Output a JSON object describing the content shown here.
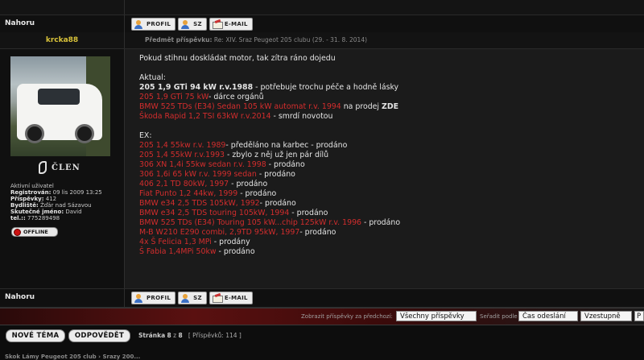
{
  "nav": {
    "top_label": "Nahoru",
    "bottom_label": "Nahoru"
  },
  "buttons": {
    "profile": "PROFIL",
    "pm": "SZ",
    "email": "E-MAIL"
  },
  "post": {
    "author": "krcka88",
    "subject_label": "Předmět příspěvku:",
    "subject": "Re: XIV. Sraz Peugeot 205 clubu (29. - 31. 8. 2014)"
  },
  "profile": {
    "rank": "ČLEN",
    "status_line": "Aktivní uživatel",
    "registered_label": "Registrován:",
    "registered": "09 lis 2009 13:25",
    "posts_label": "Příspěvky:",
    "posts": "412",
    "location_label": "Bydliště:",
    "location": "Žďár nad Sázavou",
    "realname_label": "Skutečné jméno:",
    "realname": "David",
    "phone_label": "tel.::",
    "phone": "775289498",
    "online_status": "OFFLINE"
  },
  "message": {
    "intro": "Pokud stihnu doskládat motor, tak zítra ráno dojedu",
    "current_heading": "Aktual:",
    "current": [
      {
        "main": "205 1,9 GTi 94 kW r.v.1988",
        "rest": " - potřebuje trochu péče a hodně lásky",
        "red": false
      },
      {
        "main": "205 1,9 GTi 75 kW",
        "rest": "- dárce orgánů",
        "red": true
      },
      {
        "main": "BMW 525 TDs (E34) Sedan 105 kW automat r.v. 1994",
        "rest": " na prodej ",
        "extra": "ZDE",
        "red": true
      },
      {
        "main": "Škoda Rapid 1,2 TSI 63kW r.v.2014",
        "rest": " - smrdí novotou",
        "red": true
      }
    ],
    "ex_heading": "EX:",
    "ex": [
      {
        "main": "205 1,4 55kw r.v. 1989",
        "rest": "- předěláno na karbec - prodáno"
      },
      {
        "main": "205 1,4 55kW r.v.1993",
        "rest": " - zbylo z něj už jen pár dílů"
      },
      {
        "main": "306 XN 1,4i 55kw sedan r.v. 1998",
        "rest": " - prodáno"
      },
      {
        "main": "306 1,6i 65 kW r.v. 1999 sedan",
        "rest": " - prodáno"
      },
      {
        "main": "406 2,1 TD 80kW, 1997",
        "rest": " - prodáno"
      },
      {
        "main": "Fiat Punto 1,2 44kw, 1999",
        "rest": " - prodáno"
      },
      {
        "main": "BMW e34 2,5 TDS 105kW, 1992",
        "rest": "- prodáno"
      },
      {
        "main": "BMW e34 2,5 TDS touring 105kW, 1994",
        "rest": " - prodáno"
      },
      {
        "main": "BMW 525 TDs (E34) Touring 105 kW...chip 125kW r.v. 1996",
        "rest": " - prodáno"
      },
      {
        "main": "M-B W210 E290 combi, 2,9TD 95kW, 1997",
        "rest": "- prodáno"
      },
      {
        "main": "4x Š Felicia 1,3 MPi",
        "rest": " - prodány"
      },
      {
        "main": "Š Fabia 1,4MPi 50kw",
        "rest": " - prodáno"
      }
    ]
  },
  "filter": {
    "show_label": "Zobrazit příspěvky za předchozí:",
    "show_value": "Všechny příspěvky",
    "sort_label": "Seřadit podle",
    "sort_value": "Čas odeslání",
    "order_value": "Vzestupně",
    "extra_value": "P"
  },
  "actions": {
    "new_topic": "NOVÉ TÉMA",
    "reply": "ODPOVĚDĚT",
    "page_label": "Stránka",
    "page_current": "8",
    "page_of": "z",
    "page_total": "8",
    "posts_count_text": "[ Příspěvků: 114 ]"
  },
  "footer": {
    "partial_text": "Skok Lámy Peugeot 205 club › Srazy 200..."
  },
  "colors": {
    "red_text": "#d32d2d",
    "author": "#d8c23a",
    "filter_bar": "#5a1010"
  }
}
